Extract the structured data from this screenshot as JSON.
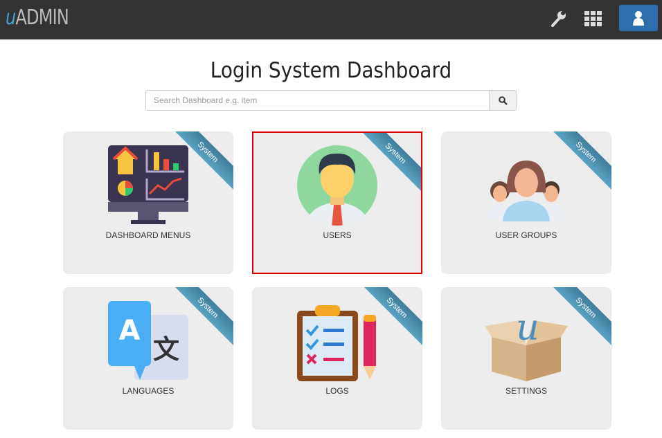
{
  "header": {
    "logo_u": "u",
    "logo_text": "ADMIN"
  },
  "page": {
    "title": "Login System Dashboard"
  },
  "search": {
    "placeholder": "Search Dashboard e.g. item"
  },
  "cards": [
    {
      "label": "DASHBOARD MENUS",
      "badge": "System",
      "icon": "dashboard-monitor-icon"
    },
    {
      "label": "USERS",
      "badge": "System",
      "icon": "user-avatar-icon"
    },
    {
      "label": "USER GROUPS",
      "badge": "System",
      "icon": "user-group-icon"
    },
    {
      "label": "LANGUAGES",
      "badge": "System",
      "icon": "translate-icon"
    },
    {
      "label": "LOGS",
      "badge": "System",
      "icon": "clipboard-log-icon"
    },
    {
      "label": "SETTINGS",
      "badge": "System",
      "icon": "box-icon"
    }
  ],
  "colors": {
    "topbar": "#333333",
    "accent": "#2e6ead",
    "ribbon": "#4a8fb0",
    "selected": "#e00000"
  }
}
